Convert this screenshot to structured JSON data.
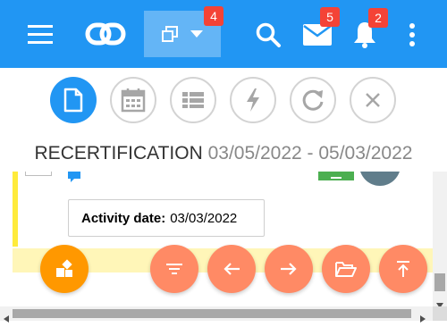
{
  "topbar": {
    "background": "#2196f3",
    "badges": {
      "windows": "4",
      "mail": "5",
      "notifications": "2"
    }
  },
  "action_bar": {
    "buttons": [
      {
        "icon": "document-icon",
        "state": "active"
      },
      {
        "icon": "calendar-icon",
        "state": "inactive"
      },
      {
        "icon": "list-icon",
        "state": "inactive"
      },
      {
        "icon": "flash-icon",
        "state": "inactive"
      },
      {
        "icon": "refresh-icon",
        "state": "inactive"
      },
      {
        "icon": "close-icon",
        "state": "inactive"
      }
    ]
  },
  "record": {
    "title": "RECERTIFICATION",
    "date_range": "03/05/2022 - 05/03/2022"
  },
  "tooltip": {
    "label": "Activity date:",
    "value": "03/03/2022"
  },
  "fabs": [
    {
      "icon": "shapes-icon",
      "color": "#ff9800"
    },
    {
      "icon": "filter-icon",
      "color": "#ff8a65"
    },
    {
      "icon": "arrow-left-icon",
      "color": "#ff8a65"
    },
    {
      "icon": "arrow-right-icon",
      "color": "#ff8a65"
    },
    {
      "icon": "folder-open-icon",
      "color": "#ff8a65"
    },
    {
      "icon": "scroll-to-top-icon",
      "color": "#ff8a65"
    }
  ],
  "colors": {
    "primary": "#2196f3",
    "badge": "#f44336",
    "highlight_row": "#fff6b8",
    "left_accent": "#ffeb3b"
  }
}
